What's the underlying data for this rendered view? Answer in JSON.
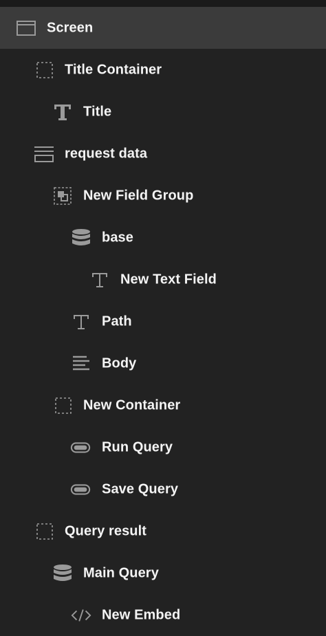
{
  "tree": {
    "items": [
      {
        "label": "Screen",
        "icon": "screen-icon",
        "depth": 0
      },
      {
        "label": "Title Container",
        "icon": "container-icon",
        "depth": 1
      },
      {
        "label": "Title",
        "icon": "text-icon",
        "depth": 2
      },
      {
        "label": "request data",
        "icon": "form-icon",
        "depth": 1
      },
      {
        "label": "New Field Group",
        "icon": "field-group-icon",
        "depth": 2
      },
      {
        "label": "base",
        "icon": "database-icon",
        "depth": 3
      },
      {
        "label": "New Text Field",
        "icon": "text-field-icon",
        "depth": 4
      },
      {
        "label": "Path",
        "icon": "text-field-icon",
        "depth": 3
      },
      {
        "label": "Body",
        "icon": "text-area-icon",
        "depth": 3
      },
      {
        "label": "New Container",
        "icon": "container-icon",
        "depth": 2
      },
      {
        "label": "Run Query",
        "icon": "button-icon",
        "depth": 3
      },
      {
        "label": "Save Query",
        "icon": "button-icon",
        "depth": 3
      },
      {
        "label": "Query result",
        "icon": "container-icon",
        "depth": 1
      },
      {
        "label": "Main Query",
        "icon": "database-icon",
        "depth": 2
      },
      {
        "label": "New Embed",
        "icon": "embed-icon",
        "depth": 3
      }
    ]
  },
  "colors": {
    "background": "#222222",
    "selected_row": "#3b3b3b",
    "text": "#f4f4f4",
    "icon": "#9a9a9a"
  }
}
